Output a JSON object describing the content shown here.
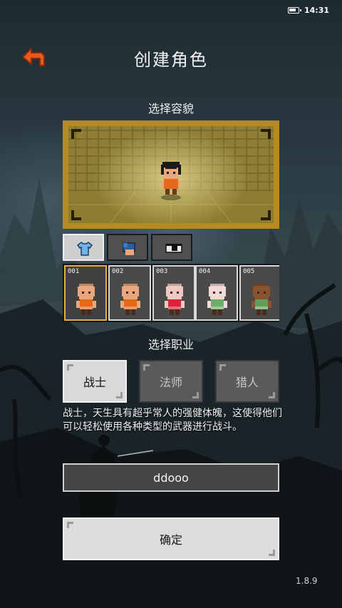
{
  "status_bar": {
    "time": "14:31",
    "battery_level": 0.85
  },
  "header": {
    "title": "创建角色",
    "back_icon": "back-arrow-icon"
  },
  "appearance": {
    "label": "选择容貌",
    "tabs": [
      {
        "icon": "shirt-icon",
        "active": true
      },
      {
        "icon": "hair-icon",
        "active": false
      },
      {
        "icon": "eye-icon",
        "active": false
      }
    ],
    "faces": [
      {
        "number": "001",
        "skin": "#e9a77b",
        "outfit": "#e46a1a",
        "selected": true
      },
      {
        "number": "002",
        "skin": "#e9a77b",
        "outfit": "#e46a1a",
        "selected": false
      },
      {
        "number": "003",
        "skin": "#f1c7c2",
        "outfit": "#d8233a",
        "selected": false
      },
      {
        "number": "004",
        "skin": "#f3d9d8",
        "outfit": "#6fae6a",
        "selected": false
      },
      {
        "number": "005",
        "skin": "#8a5330",
        "outfit": "#5ea05a",
        "selected": false
      }
    ]
  },
  "profession": {
    "label": "选择职业",
    "classes": [
      {
        "label": "战士",
        "active": true
      },
      {
        "label": "法师",
        "active": false
      },
      {
        "label": "猎人",
        "active": false
      }
    ],
    "description": "战士，天生具有超乎常人的强健体魄，这使得他们可以轻松使用各种类型的武器进行战斗。"
  },
  "name_input": {
    "value": "ddooo"
  },
  "confirm_label": "确定",
  "version": "1.8.9",
  "colors": {
    "frame_gold": "#b58a23",
    "selected_border": "#e3b02f",
    "back_arrow": "#e65a1e"
  }
}
